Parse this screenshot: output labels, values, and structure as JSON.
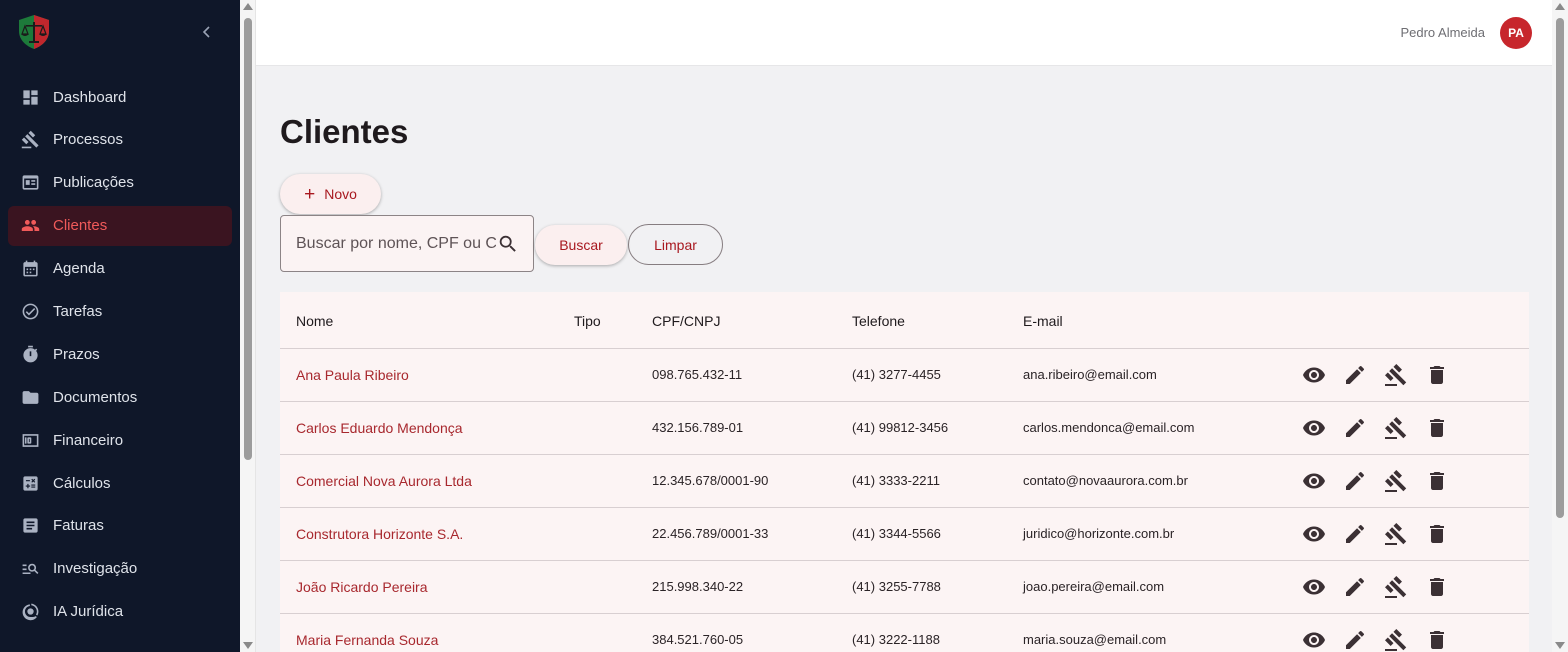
{
  "sidebar": {
    "items": [
      {
        "label": "Dashboard",
        "icon": "dashboard-icon"
      },
      {
        "label": "Processos",
        "icon": "gavel-icon"
      },
      {
        "label": "Publicações",
        "icon": "newspaper-icon"
      },
      {
        "label": "Clientes",
        "icon": "people-icon",
        "active": true
      },
      {
        "label": "Agenda",
        "icon": "calendar-icon"
      },
      {
        "label": "Tarefas",
        "icon": "check-circle-icon"
      },
      {
        "label": "Prazos",
        "icon": "stopwatch-icon"
      },
      {
        "label": "Documentos",
        "icon": "folder-icon"
      },
      {
        "label": "Financeiro",
        "icon": "money-icon"
      },
      {
        "label": "Cálculos",
        "icon": "calculator-icon"
      },
      {
        "label": "Faturas",
        "icon": "receipt-icon"
      },
      {
        "label": "Investigação",
        "icon": "manage-search-icon"
      },
      {
        "label": "IA Jurídica",
        "icon": "ai-icon"
      }
    ]
  },
  "header": {
    "user_name": "Pedro Almeida",
    "avatar_initials": "PA"
  },
  "main": {
    "title": "Clientes",
    "new_label": "Novo",
    "search_placeholder": "Buscar por nome, CPF ou CNPJ",
    "search_button": "Buscar",
    "clear_button": "Limpar"
  },
  "table": {
    "columns": [
      "Nome",
      "Tipo",
      "CPF/CNPJ",
      "Telefone",
      "E-mail"
    ],
    "rows": [
      {
        "nome": "Ana Paula Ribeiro",
        "tipo": "",
        "doc": "098.765.432-11",
        "telefone": "(41) 3277-4455",
        "email": "ana.ribeiro@email.com"
      },
      {
        "nome": "Carlos Eduardo Mendonça",
        "tipo": "",
        "doc": "432.156.789-01",
        "telefone": "(41) 99812-3456",
        "email": "carlos.mendonca@email.com"
      },
      {
        "nome": "Comercial Nova Aurora Ltda",
        "tipo": "",
        "doc": "12.345.678/0001-90",
        "telefone": "(41) 3333-2211",
        "email": "contato@novaaurora.com.br"
      },
      {
        "nome": "Construtora Horizonte S.A.",
        "tipo": "",
        "doc": "22.456.789/0001-33",
        "telefone": "(41) 3344-5566",
        "email": "juridico@horizonte.com.br"
      },
      {
        "nome": "João Ricardo Pereira",
        "tipo": "",
        "doc": "215.998.340-22",
        "telefone": "(41) 3255-7788",
        "email": "joao.pereira@email.com"
      },
      {
        "nome": "Maria Fernanda Souza",
        "tipo": "",
        "doc": "384.521.760-05",
        "telefone": "(41) 3222-1188",
        "email": "maria.souza@email.com"
      }
    ],
    "row_actions": [
      "eye-icon",
      "edit-icon",
      "gavel-icon",
      "trash-icon"
    ]
  },
  "colors": {
    "sidebar_bg": "#0f1729",
    "accent": "#a8181f",
    "active_text": "#f05a5a",
    "avatar_bg": "#c7262c"
  }
}
